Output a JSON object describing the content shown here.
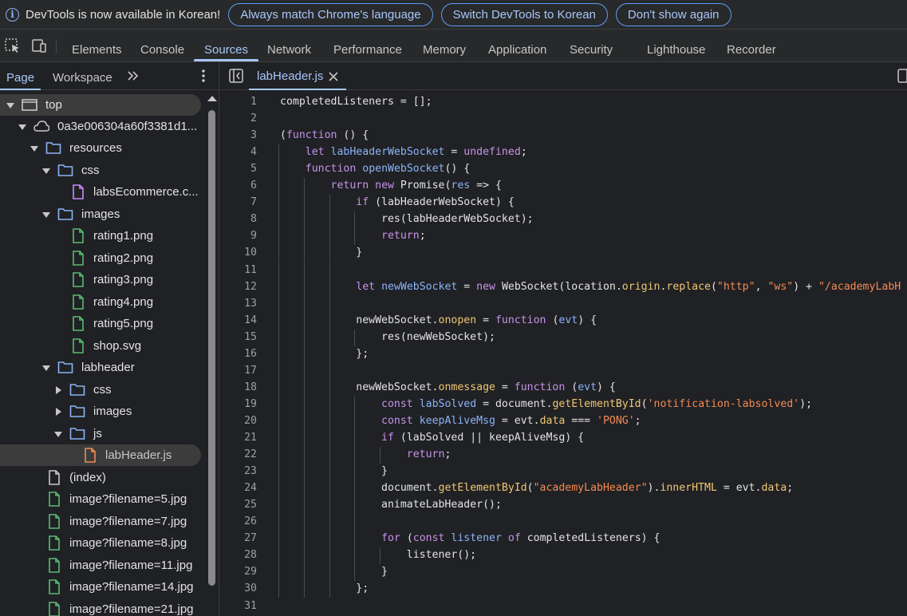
{
  "infobar": {
    "message": "DevTools is now available in Korean!",
    "buttons": [
      "Always match Chrome's language",
      "Switch DevTools to Korean",
      "Don't show again"
    ]
  },
  "main_tabs": [
    "Elements",
    "Console",
    "Sources",
    "Network",
    "Performance",
    "Memory",
    "Application",
    "Security",
    "Lighthouse",
    "Recorder"
  ],
  "active_main_tab": "Sources",
  "navigator": {
    "tabs": [
      "Page",
      "Workspace"
    ],
    "active_tab": "Page",
    "tree": [
      {
        "label": "top",
        "icon": "frame-icon",
        "expanded": true
      },
      {
        "label": "0a3e006304a60f3381d1...",
        "icon": "cloud-icon",
        "expanded": true
      },
      {
        "label": "resources",
        "icon": "folder-icon",
        "expanded": true
      },
      {
        "label": "css",
        "icon": "folder-icon",
        "expanded": true
      },
      {
        "label": "labsEcommerce.c...",
        "icon": "file-css-icon"
      },
      {
        "label": "images",
        "icon": "folder-icon",
        "expanded": true
      },
      {
        "label": "rating1.png",
        "icon": "file-image-icon"
      },
      {
        "label": "rating2.png",
        "icon": "file-image-icon"
      },
      {
        "label": "rating3.png",
        "icon": "file-image-icon"
      },
      {
        "label": "rating4.png",
        "icon": "file-image-icon"
      },
      {
        "label": "rating5.png",
        "icon": "file-image-icon"
      },
      {
        "label": "shop.svg",
        "icon": "file-image-icon"
      },
      {
        "label": "labheader",
        "icon": "folder-icon",
        "expanded": true
      },
      {
        "label": "css",
        "icon": "folder-icon",
        "expanded": false
      },
      {
        "label": "images",
        "icon": "folder-icon",
        "expanded": false
      },
      {
        "label": "js",
        "icon": "folder-icon",
        "expanded": true
      },
      {
        "label": "labHeader.js",
        "icon": "file-js-icon",
        "selected": true
      },
      {
        "label": "(index)",
        "icon": "file-document-icon"
      },
      {
        "label": "image?filename=5.jpg",
        "icon": "file-image-icon"
      },
      {
        "label": "image?filename=7.jpg",
        "icon": "file-image-icon"
      },
      {
        "label": "image?filename=8.jpg",
        "icon": "file-image-icon"
      },
      {
        "label": "image?filename=11.jpg",
        "icon": "file-image-icon"
      },
      {
        "label": "image?filename=14.jpg",
        "icon": "file-image-icon"
      },
      {
        "label": "image?filename=21.jpg",
        "icon": "file-image-icon"
      }
    ]
  },
  "editor": {
    "open_file": "labHeader.js",
    "lines": [
      "completedListeners = [];",
      "",
      "(function () {",
      "    let labHeaderWebSocket = undefined;",
      "    function openWebSocket() {",
      "        return new Promise(res => {",
      "            if (labHeaderWebSocket) {",
      "                res(labHeaderWebSocket);",
      "                return;",
      "            }",
      "",
      "            let newWebSocket = new WebSocket(location.origin.replace(\"http\", \"ws\") + \"/academyLabH",
      "",
      "            newWebSocket.onopen = function (evt) {",
      "                res(newWebSocket);",
      "            };",
      "",
      "            newWebSocket.onmessage = function (evt) {",
      "                const labSolved = document.getElementById('notification-labsolved');",
      "                const keepAliveMsg = evt.data === 'PONG';",
      "                if (labSolved || keepAliveMsg) {",
      "                    return;",
      "                }",
      "                document.getElementById(\"academyLabHeader\").innerHTML = evt.data;",
      "                animateLabHeader();",
      "",
      "                for (const listener of completedListeners) {",
      "                    listener();",
      "                }",
      "            };",
      ""
    ],
    "line_numbers": [
      "1",
      "2",
      "3",
      "4",
      "5",
      "6",
      "7",
      "8",
      "9",
      "10",
      "11",
      "12",
      "13",
      "14",
      "15",
      "16",
      "17",
      "18",
      "19",
      "20",
      "21",
      "22",
      "23",
      "24",
      "25",
      "26",
      "27",
      "28",
      "29",
      "30",
      "31"
    ]
  },
  "colors": {
    "background": "#202124",
    "accent": "#a8c7fa",
    "keyword": "#c792ea",
    "definition": "#8ab4f8",
    "property": "#f0c674",
    "string": "#f28b54"
  }
}
